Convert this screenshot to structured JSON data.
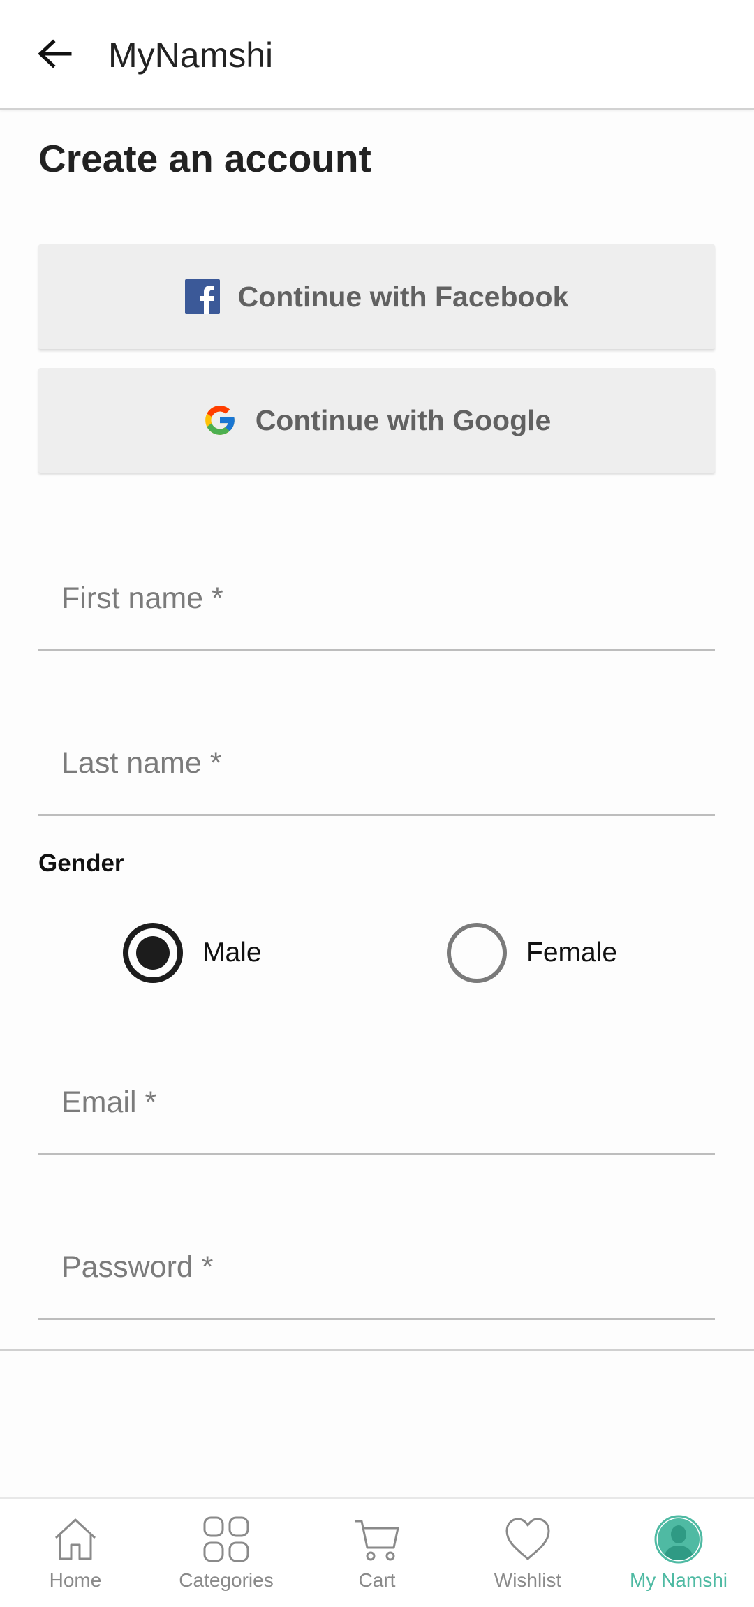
{
  "appbar": {
    "title": "MyNamshi",
    "back_icon": "arrow-left-icon"
  },
  "page": {
    "title": "Create an account"
  },
  "social": {
    "facebook_label": "Continue with Facebook",
    "google_label": "Continue with Google",
    "facebook_color": "#3b5998"
  },
  "form": {
    "first_name": {
      "placeholder": "First name *",
      "value": ""
    },
    "last_name": {
      "placeholder": "Last name *",
      "value": ""
    },
    "gender": {
      "label": "Gender",
      "options": [
        "Male",
        "Female"
      ],
      "selected": "Male"
    },
    "email": {
      "placeholder": "Email *",
      "value": ""
    },
    "password": {
      "placeholder": "Password *",
      "value": ""
    }
  },
  "bottom_nav": {
    "items": [
      {
        "label": "Home",
        "icon": "home-icon"
      },
      {
        "label": "Categories",
        "icon": "grid-icon"
      },
      {
        "label": "Cart",
        "icon": "cart-icon"
      },
      {
        "label": "Wishlist",
        "icon": "heart-icon"
      },
      {
        "label": "My Namshi",
        "icon": "user-avatar-icon",
        "active": true
      }
    ],
    "active_color": "#4fbaa3",
    "inactive_color": "#8a8a8a"
  }
}
